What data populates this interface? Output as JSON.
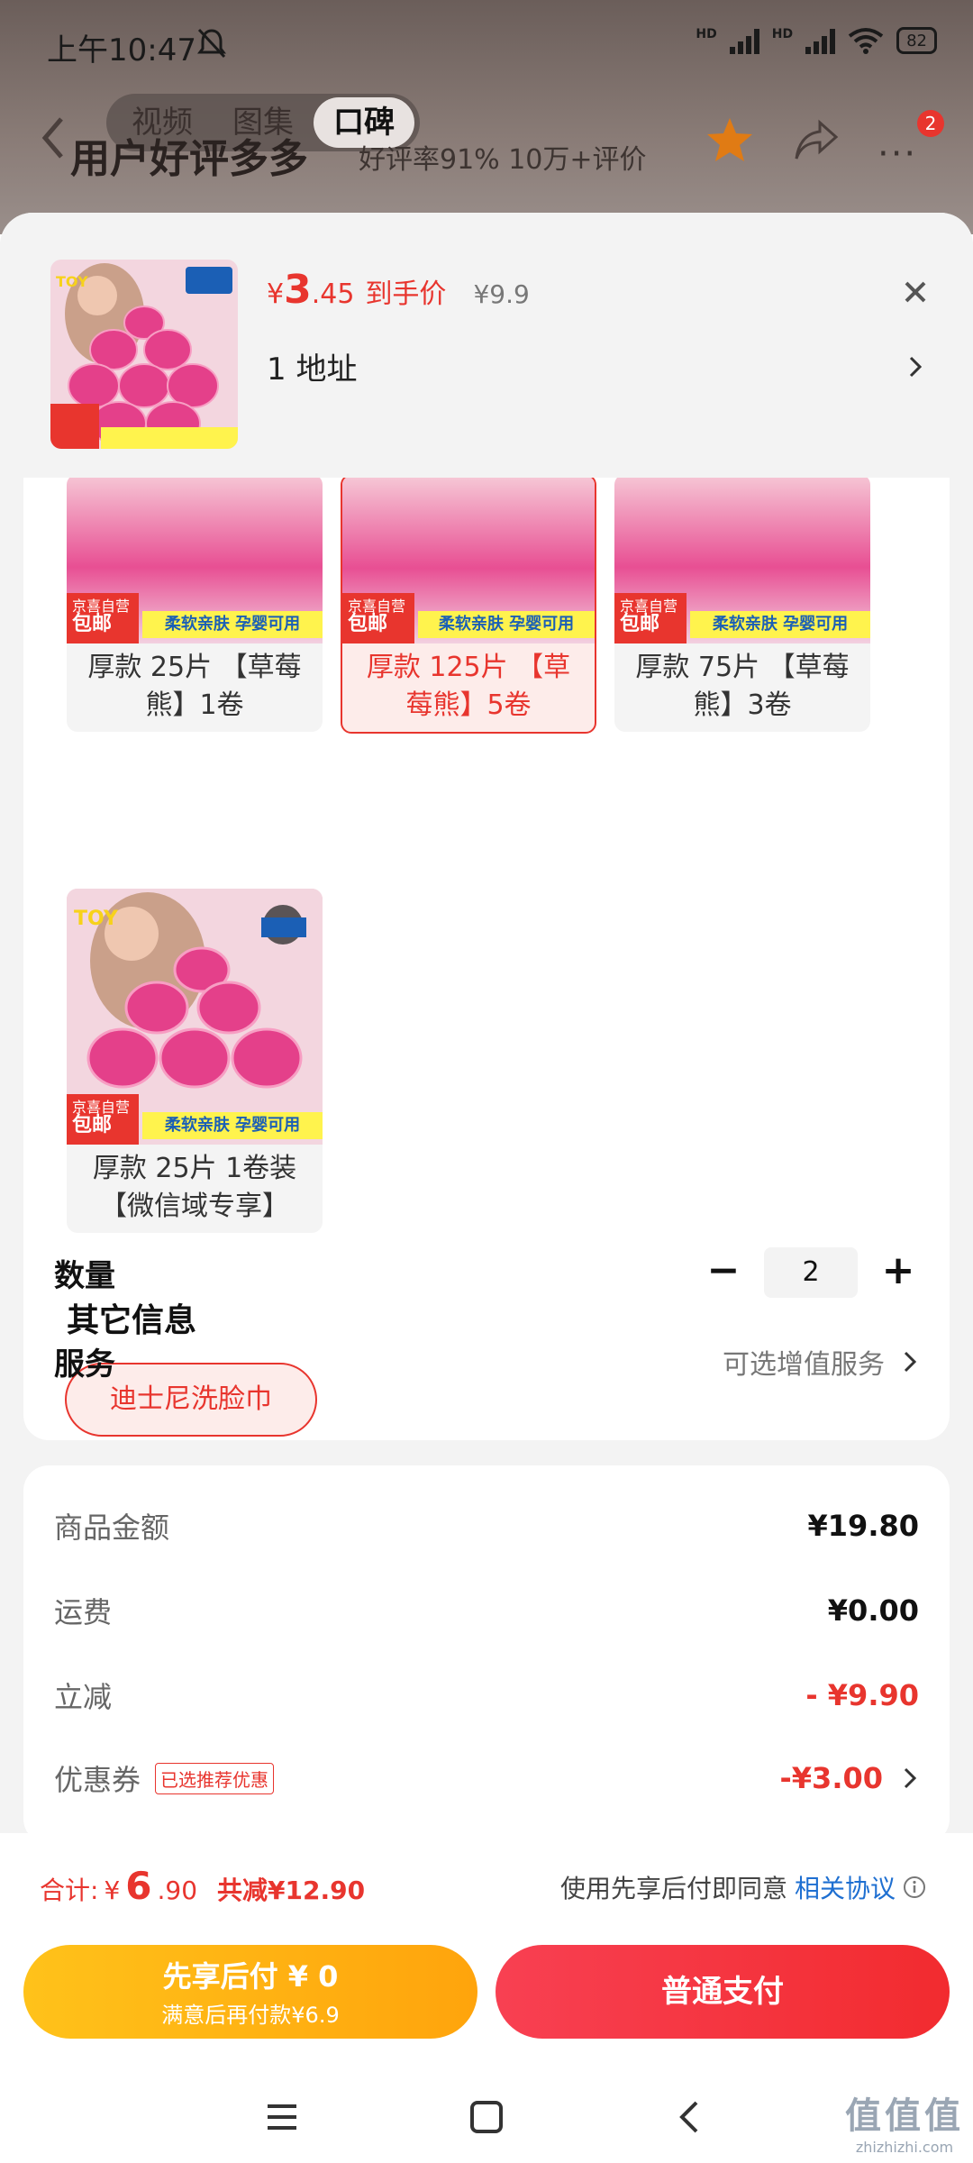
{
  "status_bar": {
    "time": "上午10:47",
    "hd1": "HD",
    "hd2": "HD",
    "battery": "82"
  },
  "background": {
    "tabs": [
      "视频",
      "图集",
      "口碑"
    ],
    "title": "用户好评多多",
    "subtitle": "好评率91% 10万+评价",
    "badge": "2"
  },
  "product": {
    "currency": "¥",
    "price_int": "3",
    "price_dec": ".45",
    "price_tag": "到手价",
    "original_price": "¥9.9",
    "address": "1  地址"
  },
  "options": [
    {
      "label": "厚款 25片 【草莓熊】1卷",
      "selected": false
    },
    {
      "label": "厚款 125片 【草莓熊】5卷",
      "selected": true
    },
    {
      "label": "厚款 75片 【草莓熊】3卷",
      "selected": false
    },
    {
      "label": "厚款 25片 1卷装【微信域专享】",
      "selected": false
    }
  ],
  "tags": {
    "jd_line1": "京喜自营",
    "jd_line2": "包邮",
    "soft": "柔软亲肤 孕婴可用"
  },
  "other_info": {
    "title": "其它信息",
    "chip": "迪士尼洗脸巾"
  },
  "quantity": {
    "label": "数量",
    "value": "2",
    "minus": "−",
    "plus": "+"
  },
  "service": {
    "label": "服务",
    "value": "可选增值服务"
  },
  "bill": {
    "goods_label": "商品金额",
    "goods_value": "¥19.80",
    "shipping_label": "运费",
    "shipping_value": "¥0.00",
    "discount_label": "立减",
    "discount_value": "- ¥9.90",
    "coupon_label": "优惠券",
    "coupon_tag": "已选推荐优惠",
    "coupon_value": "-¥3.00"
  },
  "footer": {
    "total_label": "合计:",
    "total_currency": "¥",
    "total_int": "6",
    "total_dec": ".90",
    "total_saved": "共减¥12.90",
    "agree_text": "使用先享后付即同意",
    "agree_link": "相关协议",
    "pay_later_line1": "先享后付 ¥ 0",
    "pay_later_line2": "满意后再付款¥6.9",
    "pay_normal": "普通支付"
  },
  "watermark": {
    "line1": "值值值",
    "line2": "zhizhizhi.com"
  },
  "colors": {
    "accent": "#e8352e",
    "pay_later": "#ffb313",
    "link": "#1e6fd1"
  }
}
